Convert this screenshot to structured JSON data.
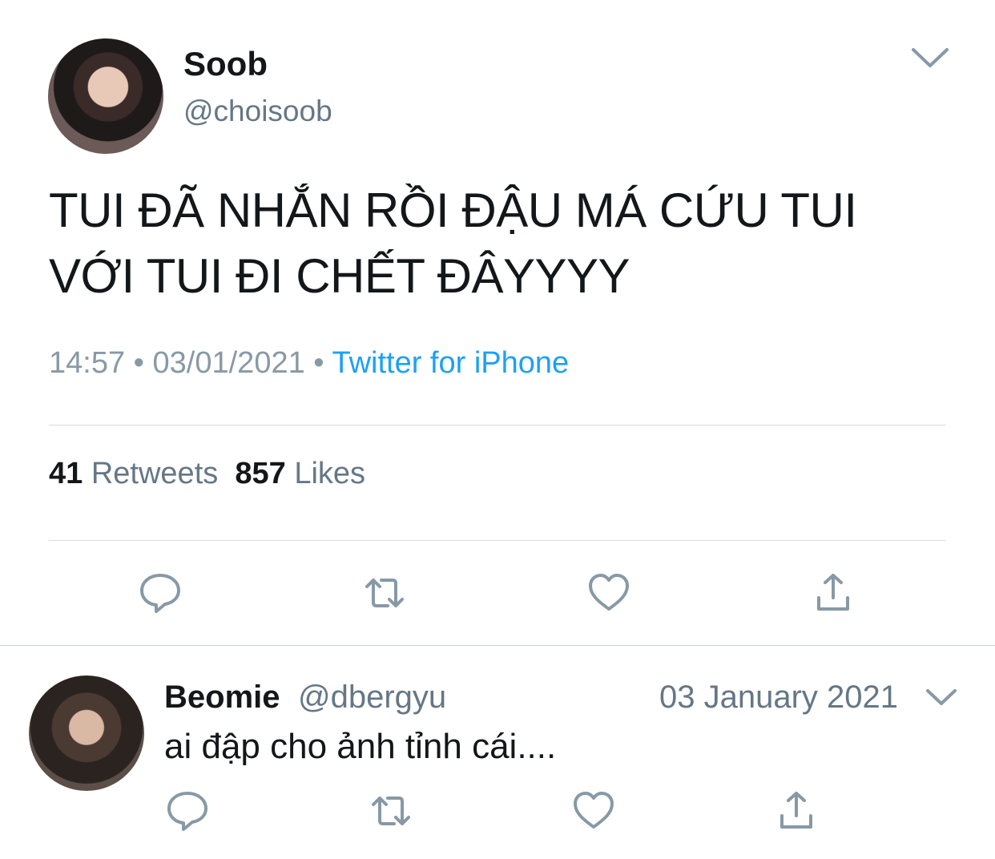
{
  "tweet": {
    "author_name": "Soob",
    "author_handle": "@choisoob",
    "text": "TUI ĐÃ NHẮN RỒI ĐẬU MÁ CỨU TUI VỚI TUI ĐI CHẾT ĐÂYYYY",
    "time": "14:57",
    "separator": "•",
    "date": "03/01/2021",
    "source": "Twitter for iPhone",
    "retweets_count": "41",
    "retweets_label": "Retweets",
    "likes_count": "857",
    "likes_label": "Likes"
  },
  "reply": {
    "author_name": "Beomie",
    "author_handle": "@dbergyu",
    "date": "03 January 2021",
    "text": "ai đập cho ảnh tỉnh cái...."
  },
  "colors": {
    "accent": "#1da1f2",
    "text_primary": "#14171a",
    "text_secondary": "#657786",
    "icon": "#657786",
    "divider": "#d8dde1"
  },
  "icons": {
    "reply": "reply-icon",
    "retweet": "retweet-icon",
    "like": "heart-icon",
    "share": "share-icon",
    "more": "chevron-down-icon"
  }
}
